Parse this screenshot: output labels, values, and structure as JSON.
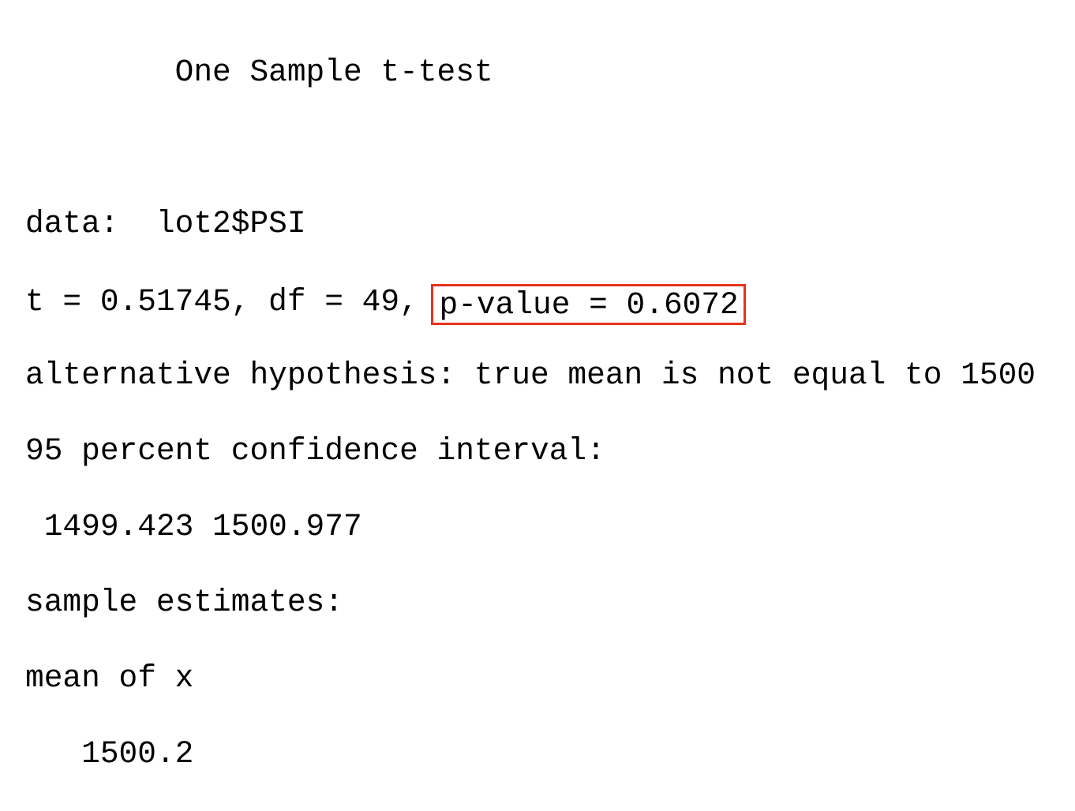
{
  "output": {
    "title": "        One Sample t-test",
    "blank": "",
    "data_line": "data:  lot2$PSI",
    "stats_prefix": "t = 0.51745, df = 49, ",
    "p_value": "p-value = 0.6072",
    "alternative": "alternative hypothesis: true mean is not equal to 1500",
    "ci_label": "95 percent confidence interval:",
    "ci_values": " 1499.423 1500.977",
    "estimates_label": "sample estimates:",
    "estimate_name": "mean of x",
    "estimate_value": "   1500.2"
  },
  "colors": {
    "highlight": "#e8321e",
    "text": "#000000",
    "background": "#ffffff"
  }
}
